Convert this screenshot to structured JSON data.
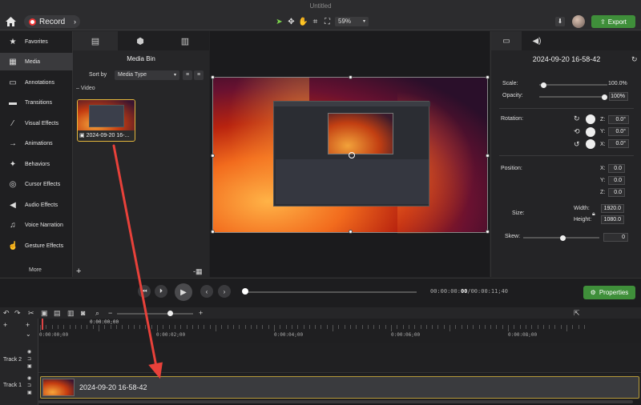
{
  "window": {
    "title": "Untitled"
  },
  "toolbar": {
    "record_label": "Record",
    "zoom_value": "59%",
    "export_label": "Export"
  },
  "sidebar": {
    "items": [
      {
        "label": "Favorites",
        "icon": "star-icon"
      },
      {
        "label": "Media",
        "icon": "film-icon"
      },
      {
        "label": "Annotations",
        "icon": "annotation-icon"
      },
      {
        "label": "Transitions",
        "icon": "transition-icon"
      },
      {
        "label": "Visual Effects",
        "icon": "wand-icon"
      },
      {
        "label": "Animations",
        "icon": "animation-icon"
      },
      {
        "label": "Behaviors",
        "icon": "behavior-icon"
      },
      {
        "label": "Cursor Effects",
        "icon": "cursor-icon"
      },
      {
        "label": "Audio Effects",
        "icon": "speaker-icon"
      },
      {
        "label": "Voice Narration",
        "icon": "microphone-icon"
      },
      {
        "label": "Gesture Effects",
        "icon": "hand-icon"
      }
    ],
    "more_label": "More"
  },
  "media_bin": {
    "title": "Media Bin",
    "sort_by_label": "Sort by",
    "sort_by_value": "Media Type",
    "section_label": "Video",
    "clip_name": "2024-09-20 16-..."
  },
  "properties": {
    "title": "2024-09-20 16-58-42",
    "scale_label": "Scale:",
    "scale_value": "100.0%",
    "scale_fraction": 1.0,
    "opacity_label": "Opacity:",
    "opacity_value": "100%",
    "rotation_label": "Rotation:",
    "rotation_z": "0.0°",
    "rotation_y": "0.0°",
    "rotation_x": "0.0°",
    "position_label": "Position:",
    "pos_x": "0.0",
    "pos_y": "0.0",
    "pos_z": "0.0",
    "size_label": "Size:",
    "width_label": "Width:",
    "width_value": "1920.0",
    "height_label": "Height:",
    "height_value": "1080.0",
    "skew_label": "Skew:",
    "skew_value": "0",
    "axis_x": "X:",
    "axis_y": "Y:",
    "axis_z": "Z:"
  },
  "playback": {
    "timecode_current": "00:00:00",
    "timecode_frames": "00",
    "timecode_total": "/00:00:11;40",
    "properties_button": "Properties"
  },
  "timeline": {
    "playhead_time": "0:00:00;00",
    "ruler_labels": [
      "0:00:00;00",
      "0:00:02;00",
      "0:00:04;00",
      "0:00:06;00",
      "0:00:08;00"
    ],
    "tracks": [
      {
        "name": "Track 2"
      },
      {
        "name": "Track 1"
      }
    ],
    "clip_label": "2024-09-20 16-58-42"
  },
  "colors": {
    "accent_green": "#3f8f3a",
    "record_red": "#e33333",
    "annotation_arrow": "#e8413a"
  }
}
